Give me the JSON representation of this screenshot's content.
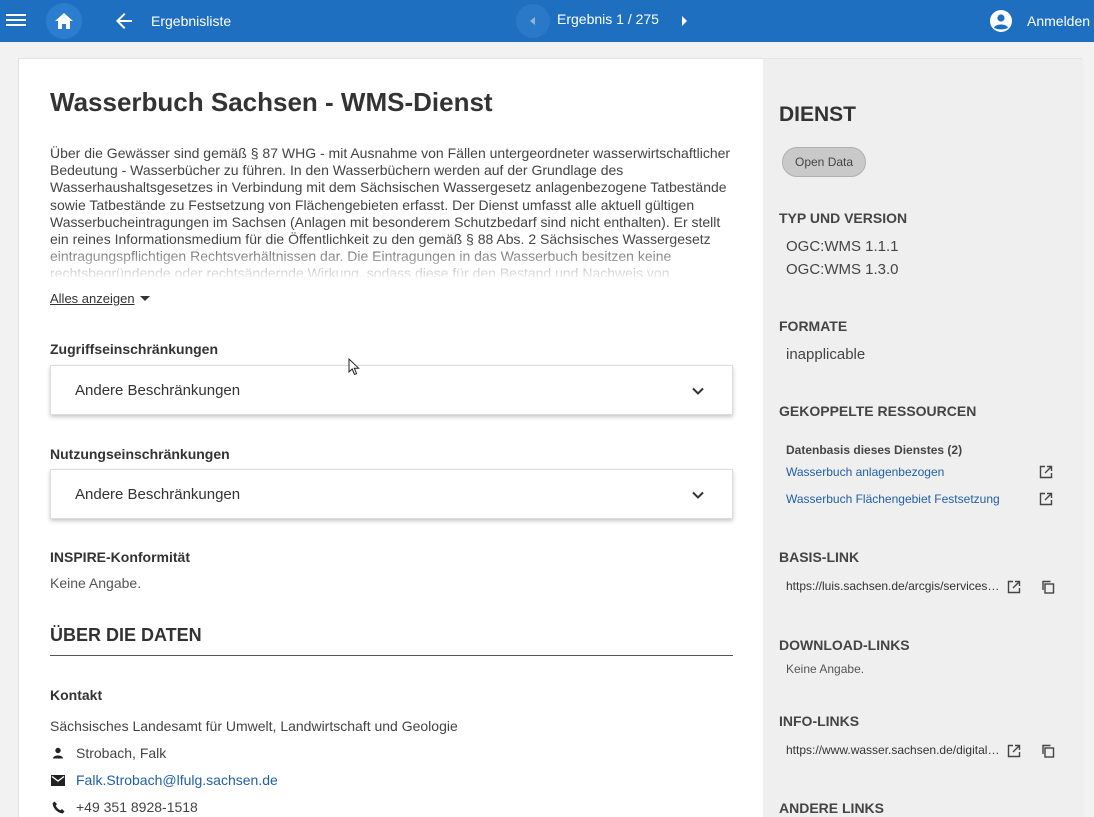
{
  "topbar": {
    "back_label": "Ergebnisliste",
    "result_counter": "Ergebnis 1 / 275",
    "login_label": "Anmelden"
  },
  "main": {
    "title": "Wasserbuch Sachsen - WMS-Dienst",
    "description": "Über die Gewässer sind gemäß § 87 WHG - mit Ausnahme von Fällen untergeordneter wasserwirtschaftlicher Bedeutung - Wasserbücher zu führen. In den Wasserbüchern werden auf der Grundlage des Wasserhaushaltsgesetzes in Verbindung mit dem Sächsischen Wassergesetz anlagenbezogene Tatbestände sowie Tatbestände zu Festsetzung von Flächengebieten erfasst. Der Dienst umfasst alle aktuell gültigen Wasserbucheintragungen im Sachsen (Anlagen mit besonderem Schutzbedarf sind nicht enthalten). Er stellt ein reines Informationsmedium für die Öffentlichkeit zu den gemäß § 88 Abs. 2 Sächsisches Wassergesetz eintragungspflichtigen Rechtsverhältnissen dar. Die Eintragungen in das Wasserbuch besitzen keine rechtsbegründende oder rechtsändernde Wirkung, sodass diese für den Bestand und Nachweis von",
    "show_all": "Alles anzeigen",
    "access_label": "Zugriffseinschränkungen",
    "access_value": "Andere Beschränkungen",
    "usage_label": "Nutzungseinschränkungen",
    "usage_value": "Andere Beschränkungen",
    "inspire_label": "INSPIRE-Konformität",
    "inspire_value": "Keine Angabe.",
    "about_heading": "ÜBER DIE DATEN",
    "contact_label": "Kontakt",
    "contact_org": "Sächsisches Landesamt für Umwelt, Landwirtschaft und Geologie",
    "contact_person": "Strobach, Falk",
    "contact_email": "Falk.Strobach@lfulg.sachsen.de",
    "contact_phone": "+49 351 8928-1518"
  },
  "sidebar": {
    "heading": "DIENST",
    "badge": "Open Data",
    "type_heading": "TYP UND VERSION",
    "type_values": [
      "OGC:WMS 1.1.1",
      "OGC:WMS 1.3.0"
    ],
    "formats_heading": "FORMATE",
    "formats_value": "inapplicable",
    "coupled_heading": "GEKOPPELTE RESSOURCEN",
    "coupled_sub": "Datenbasis dieses Dienstes (2)",
    "coupled_links": [
      "Wasserbuch anlagenbezogen",
      "Wasserbuch Flächengebiet Festsetzung"
    ],
    "base_heading": "BASIS-LINK",
    "base_url": "https://luis.sachsen.de/arcgis/services/wasser/wasserbuch/MapServer/WMSServer",
    "download_heading": "DOWNLOAD-LINKS",
    "download_value": "Keine Angabe.",
    "info_heading": "INFO-LINKS",
    "info_url": "https://www.wasser.sachsen.de/digitales-wasserbuch.html",
    "other_heading": "ANDERE LINKS"
  },
  "colors": {
    "topbar": "#1f6fc1",
    "link": "#1f5fa8",
    "sidebar_bg": "#efefef"
  }
}
